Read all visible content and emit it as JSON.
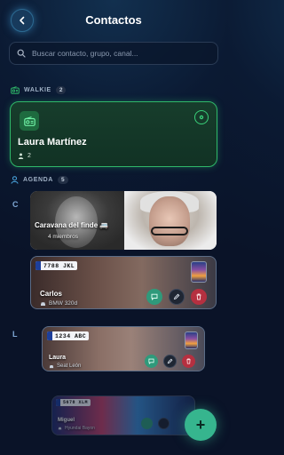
{
  "header": {
    "title": "Contactos",
    "back_icon": "chevron-left-icon"
  },
  "search": {
    "placeholder": "Buscar contacto, grupo, canal...",
    "icon": "search-icon"
  },
  "walkie": {
    "section_label": "WALKIE",
    "count": "2",
    "card": {
      "name": "Laura Martínez",
      "members": "2",
      "accent": "#2fb86a"
    }
  },
  "agenda": {
    "section_label": "AGENDA",
    "count": "5",
    "letters": [
      "C",
      "L"
    ],
    "group": {
      "name": "Caravana del finde",
      "emoji": "🚐",
      "subtitle": "4 miembros"
    },
    "contacts": [
      {
        "name": "Carlos",
        "plate": "7788 JKL",
        "car": "BMW 320d"
      },
      {
        "name": "Laura",
        "plate": "1234 ABC",
        "car": "Seat León"
      },
      {
        "name": "Miguel",
        "plate": "5678 XLM",
        "car": "Hyundai Bayon"
      }
    ]
  },
  "colors": {
    "chat": "#2f9a7b",
    "delete": "#b53040",
    "fab": "#36b58e",
    "background": "#0b1a33"
  },
  "fab": {
    "label": "+"
  }
}
